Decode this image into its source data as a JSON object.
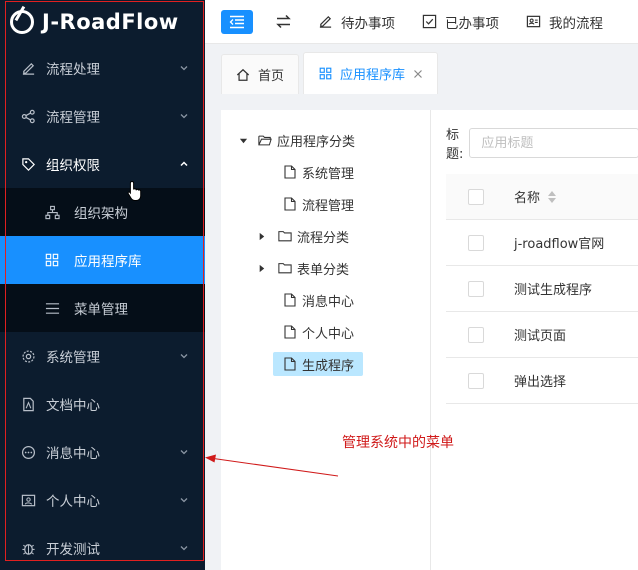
{
  "app": {
    "logo_text": "J-RoadFlow"
  },
  "sidebar": {
    "items": [
      {
        "label": "流程处理",
        "icon": "edit-icon",
        "expanded": false
      },
      {
        "label": "流程管理",
        "icon": "share-icon",
        "expanded": false
      },
      {
        "label": "组织权限",
        "icon": "tag-icon",
        "expanded": true,
        "children": [
          {
            "label": "组织架构",
            "icon": "org-chart-icon",
            "active": false
          },
          {
            "label": "应用程序库",
            "icon": "grid-icon",
            "active": true
          },
          {
            "label": "菜单管理",
            "icon": "menu-lines-icon",
            "active": false
          }
        ]
      },
      {
        "label": "系统管理",
        "icon": "gear-icon",
        "expanded": false
      },
      {
        "label": "文档中心",
        "icon": "document-icon",
        "expanded": false
      },
      {
        "label": "消息中心",
        "icon": "chat-icon",
        "expanded": false
      },
      {
        "label": "个人中心",
        "icon": "id-card-icon",
        "expanded": false
      },
      {
        "label": "开发测试",
        "icon": "bug-icon",
        "expanded": false
      }
    ]
  },
  "toolbar": {
    "links": [
      {
        "label": "待办事项",
        "icon": "edit-icon"
      },
      {
        "label": "已办事项",
        "icon": "checkbox-icon"
      },
      {
        "label": "我的流程",
        "icon": "id-card-icon"
      }
    ]
  },
  "tabs": [
    {
      "label": "首页",
      "icon": "home-icon",
      "active": false
    },
    {
      "label": "应用程序库",
      "icon": "grid-icon",
      "active": true
    }
  ],
  "tree": {
    "root": "应用程序分类",
    "nodes": [
      {
        "label": "系统管理",
        "type": "file"
      },
      {
        "label": "流程管理",
        "type": "file"
      },
      {
        "label": "流程分类",
        "type": "folder"
      },
      {
        "label": "表单分类",
        "type": "folder"
      },
      {
        "label": "消息中心",
        "type": "file"
      },
      {
        "label": "个人中心",
        "type": "file"
      },
      {
        "label": "生成程序",
        "type": "file",
        "selected": true
      }
    ]
  },
  "search": {
    "label": "标题:",
    "placeholder": "应用标题"
  },
  "table": {
    "header": "名称",
    "rows": [
      "j-roadflow官网",
      "测试生成程序",
      "测试页面",
      "弹出选择"
    ]
  },
  "annotation": {
    "text": "管理系统中的菜单"
  },
  "colors": {
    "sidebar_bg": "#0c1c2e",
    "accent": "#1890ff",
    "annotation": "#d01a1a"
  }
}
